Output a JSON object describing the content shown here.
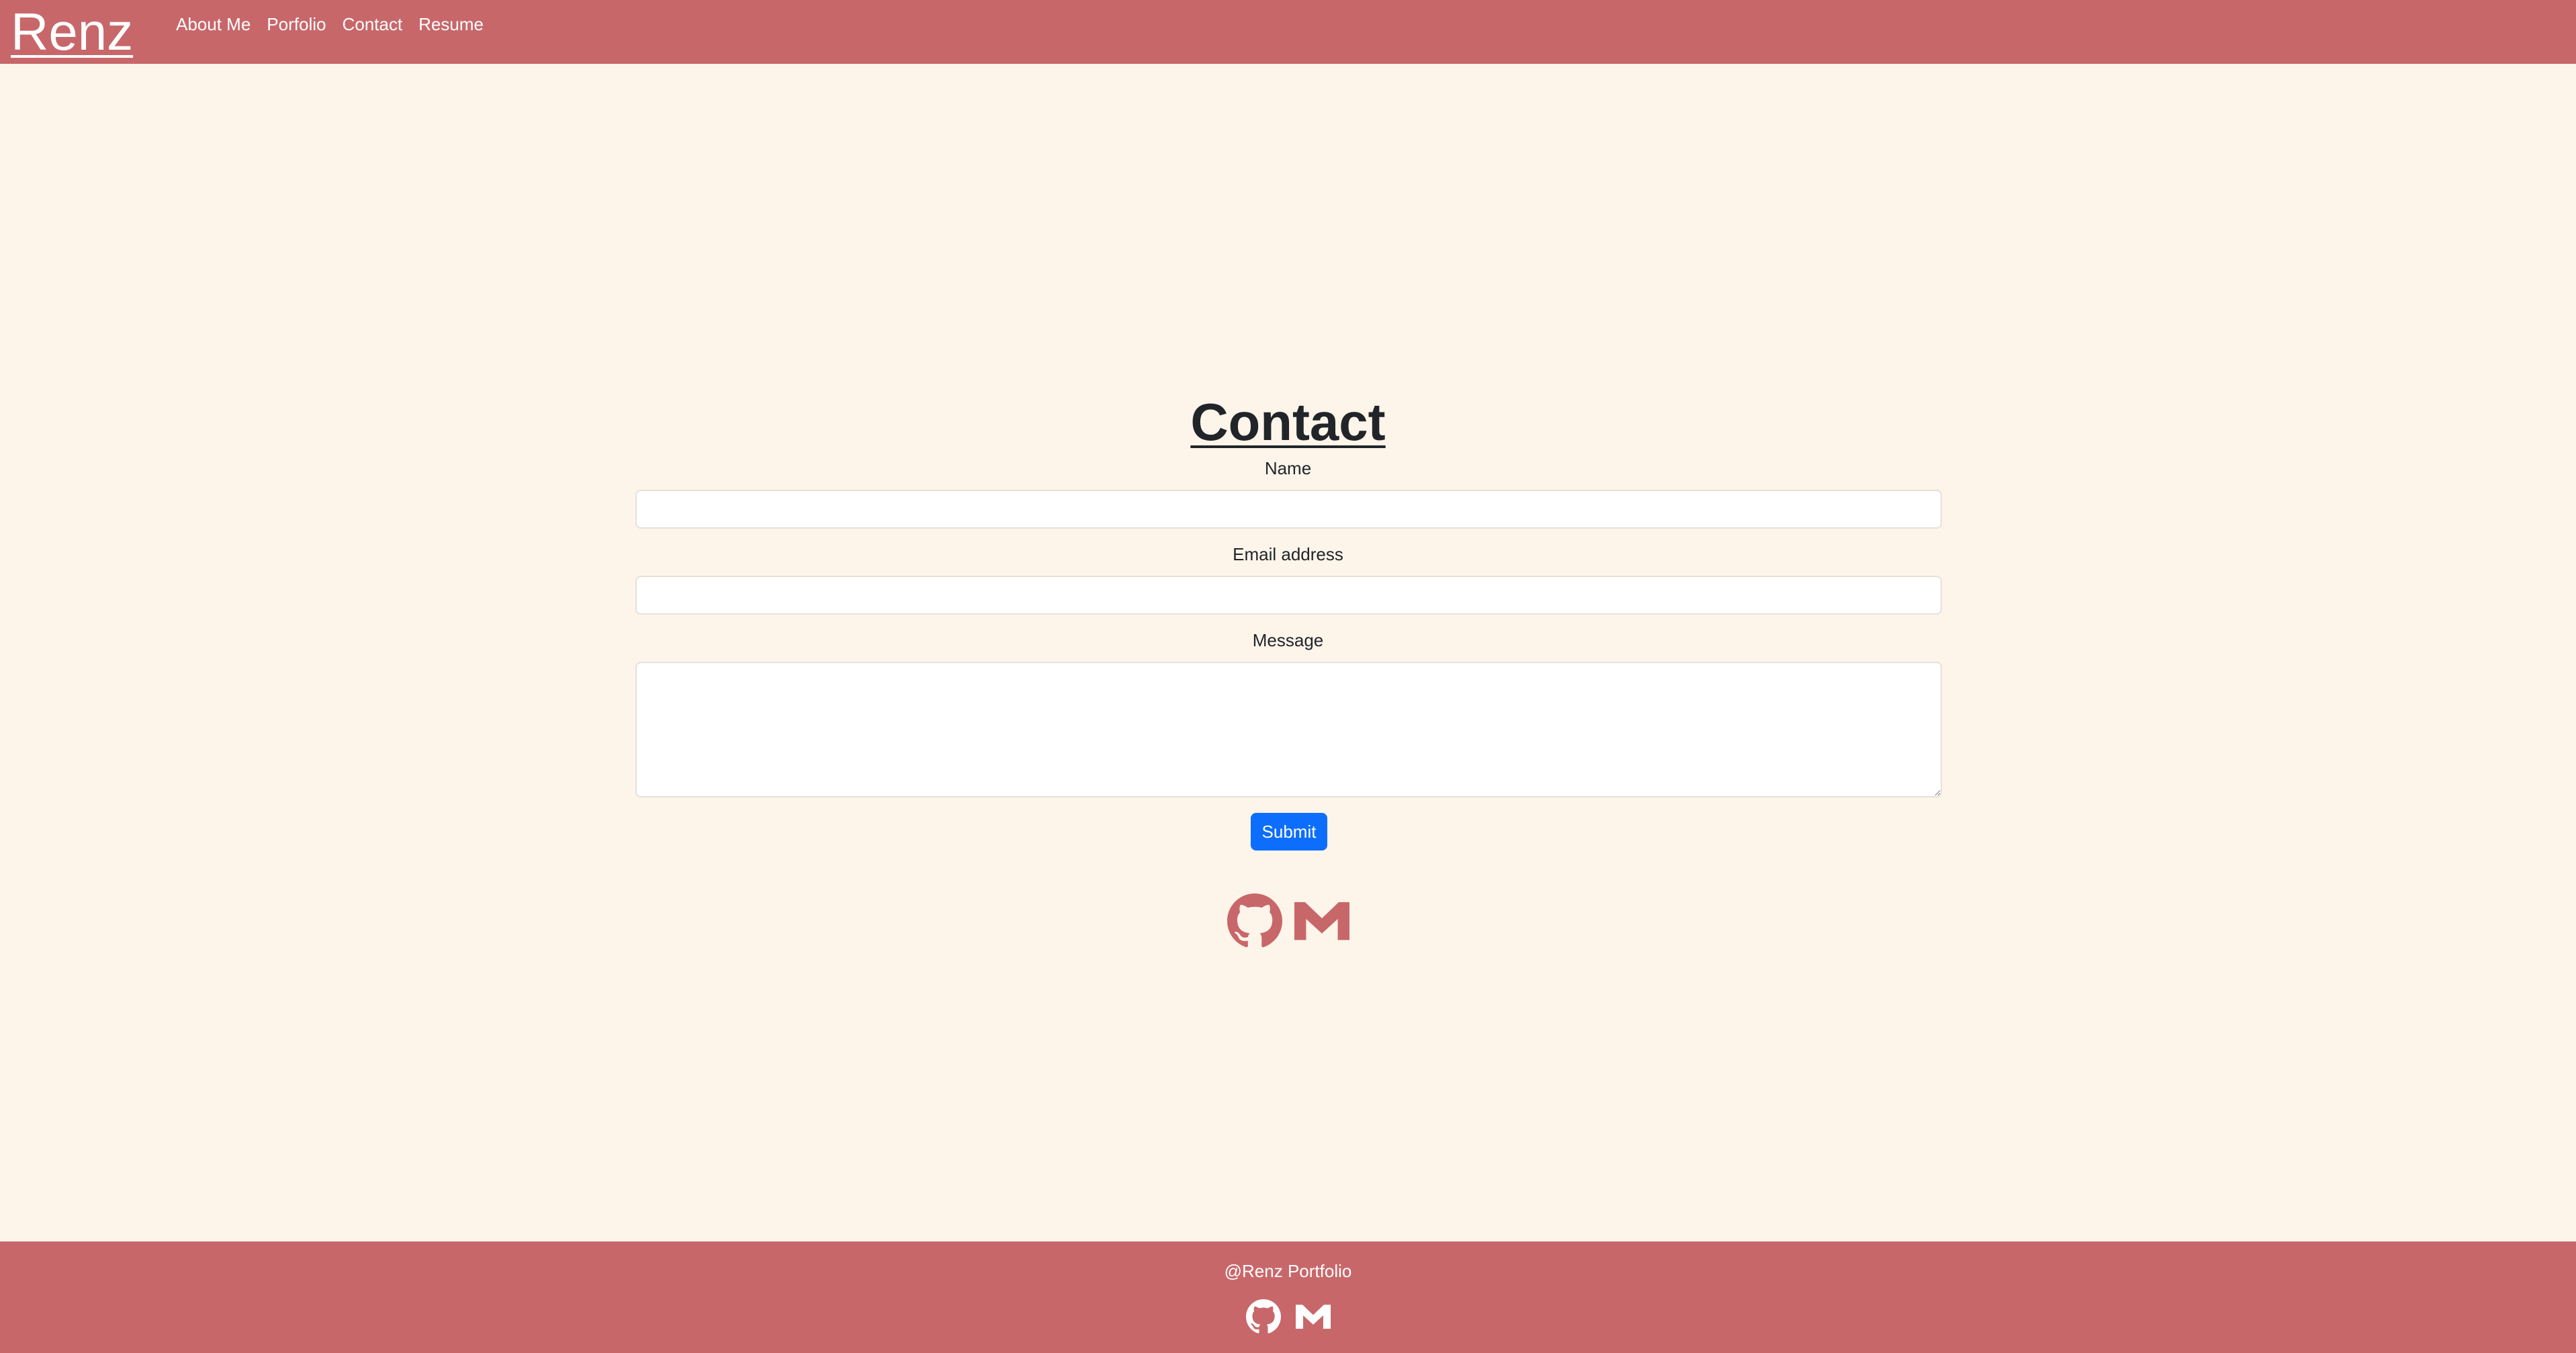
{
  "navbar": {
    "brand": "Renz",
    "links": [
      {
        "label": "About Me"
      },
      {
        "label": "Porfolio"
      },
      {
        "label": "Contact"
      },
      {
        "label": "Resume"
      }
    ]
  },
  "contact": {
    "title": "Contact",
    "name_label": "Name",
    "name_value": "",
    "email_label": "Email address",
    "email_value": "",
    "message_label": "Message",
    "message_value": "",
    "submit_label": "Submit",
    "social_icons": [
      "github-icon",
      "gmail-icon"
    ]
  },
  "footer": {
    "text": "@Renz Portfolio",
    "social_icons": [
      "github-icon",
      "gmail-icon"
    ]
  },
  "colors": {
    "nav_bg": "#c8676a",
    "page_bg": "#fdf4ea",
    "accent_icon": "#c8676a",
    "button_bg": "#0d6efd",
    "text": "#212529"
  }
}
